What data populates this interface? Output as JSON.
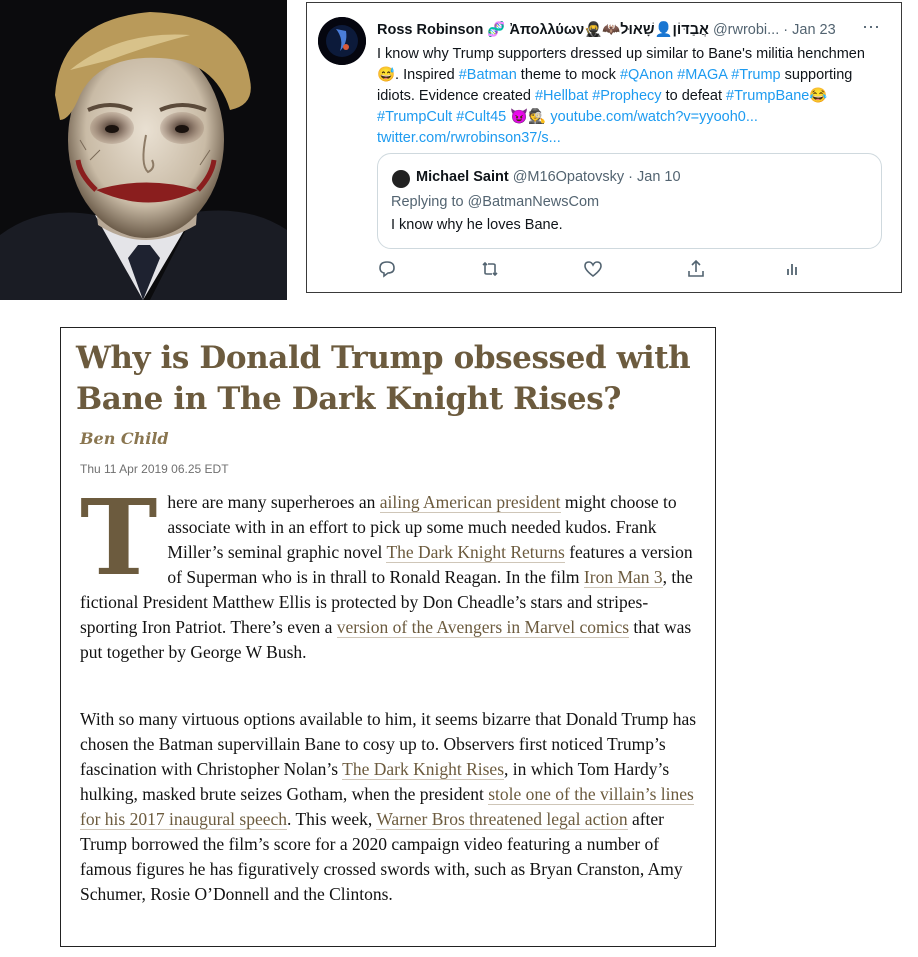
{
  "tweet": {
    "name": "Ross Robinson",
    "name_suffix": " 🧬 Ἀπολλύων🥷🦇אֲבַדּוֹן👤שָׁאוּל",
    "handle": " @rwrobi...",
    "separator": " · ",
    "date": "Jan 23",
    "more_icon": "⋯",
    "text_segments": {
      "t1": "I know why Trump supporters dressed up similar to Bane's militia henchmen 😅. Inspired ",
      "h1": "#Batman",
      "t2": " theme to mock ",
      "h2": "#QAnon",
      "t3": " ",
      "h3": "#MAGA",
      "t4": " ",
      "h4": "#Trump",
      "t5": " supporting idiots. Evidence created ",
      "h5": "#Hellbat",
      "t6": " ",
      "h6": "#Prophecy",
      "t7": " to defeat ",
      "h7": "#TrumpBane",
      "t8": "😂 ",
      "h8": "#TrumpCult",
      "t9": " ",
      "h9": "#Cult45",
      "t10": " 😈🕵 ",
      "l1": "youtube.com/watch?v=yyooh0...",
      "t11": " ",
      "l2": "twitter.com/rwrobinson37/s..."
    },
    "quote": {
      "name": "Michael Saint",
      "handle": " @M16Opatovsky",
      "date": " · Jan 10",
      "replying": "Replying to @BatmanNewsCom",
      "text": "I know why he loves Bane."
    },
    "actions": [
      "reply-icon",
      "retweet-icon",
      "like-icon",
      "share-icon",
      "analytics-icon"
    ]
  },
  "article": {
    "headline": "Why is Donald Trump obsessed with Bane in The Dark Knight Rises?",
    "author": "Ben Child",
    "date": "Thu 11 Apr 2019 06.25 EDT",
    "p1": {
      "dropcap": "T",
      "s1": "here are many superheroes an ",
      "l1": "ailing American president",
      "s2": " might choose to associate with in an effort to pick up some much needed kudos. Frank Miller’s seminal graphic novel ",
      "l2": "The Dark Knight Returns",
      "s3": " features a version of Superman who is in thrall to Ronald Reagan. In the film ",
      "l3": "Iron Man 3",
      "s4": ", the fictional President Matthew Ellis is protected by Don Cheadle’s stars and stripes-sporting Iron Patriot. There’s even a ",
      "l4": "version of the Avengers in Marvel comics",
      "s5": " that was put together by George W Bush."
    },
    "p2": {
      "s1": "With so many virtuous options available to him, it seems bizarre that Donald Trump has chosen the Batman supervillain Bane to cosy up to. Observers first noticed Trump’s fascination with Christopher Nolan’s ",
      "l1": "The Dark Knight Rises",
      "s2": ", in which Tom Hardy’s hulking, masked brute seizes Gotham, when the president ",
      "l2": "stole one of the villain’s lines for his 2017 inaugural speech",
      "s3": ". This week, ",
      "l3": "Warner Bros threatened legal action",
      "s4": " after Trump borrowed the film’s score for a 2020 campaign video featuring a number of famous figures he has figuratively crossed swords with, such as Bryan Cranston, Amy Schumer, Rosie O’Donnell and the Clintons."
    }
  },
  "colors": {
    "twitter_link": "#1d9bf0",
    "guardian_brown": "#6c5b3e"
  }
}
